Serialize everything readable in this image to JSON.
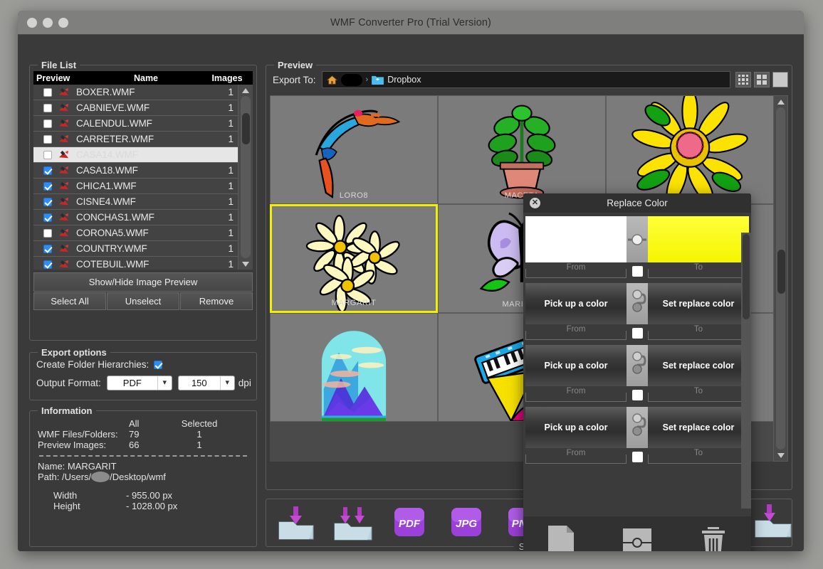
{
  "window": {
    "title": "WMF Converter Pro (Trial Version)",
    "traffic_labels": [
      "close",
      "minimize",
      "zoom"
    ]
  },
  "file_list": {
    "legend": "File List",
    "columns": [
      "Preview",
      "Name",
      "Images"
    ],
    "rows": [
      {
        "checked": false,
        "name": "BOXER.WMF",
        "images": "1",
        "selected": false
      },
      {
        "checked": false,
        "name": "CABNIEVE.WMF",
        "images": "1",
        "selected": false
      },
      {
        "checked": false,
        "name": "CALENDUL.WMF",
        "images": "1",
        "selected": false
      },
      {
        "checked": false,
        "name": "CARRETER.WMF",
        "images": "1",
        "selected": false
      },
      {
        "checked": false,
        "name": "CASA14.WMF",
        "images": "",
        "selected": true
      },
      {
        "checked": true,
        "name": "CASA18.WMF",
        "images": "1",
        "selected": false
      },
      {
        "checked": true,
        "name": "CHICA1.WMF",
        "images": "1",
        "selected": false
      },
      {
        "checked": true,
        "name": "CISNE4.WMF",
        "images": "1",
        "selected": false
      },
      {
        "checked": true,
        "name": "CONCHAS1.WMF",
        "images": "1",
        "selected": false
      },
      {
        "checked": false,
        "name": "CORONA5.WMF",
        "images": "1",
        "selected": false
      },
      {
        "checked": true,
        "name": "COUNTRY.WMF",
        "images": "1",
        "selected": false
      },
      {
        "checked": true,
        "name": "COTEBUIL.WMF",
        "images": "1",
        "selected": false
      }
    ],
    "show_hide_label": "Show/Hide Image Preview",
    "select_all_label": "Select All",
    "unselect_label": "Unselect",
    "remove_label": "Remove"
  },
  "export_options": {
    "legend": "Export options",
    "folder_hierarchies_label": "Create Folder Hierarchies:",
    "folder_hierarchies_checked": true,
    "output_format_label": "Output Format:",
    "format_value": "PDF",
    "dpi_value": "150",
    "dpi_unit": "dpi"
  },
  "information": {
    "legend": "Information",
    "col_all": "All",
    "col_selected": "Selected",
    "rows": [
      {
        "label": "WMF Files/Folders:",
        "all": "79",
        "selected": "1"
      },
      {
        "label": "Preview Images:",
        "all": "66",
        "selected": "1"
      }
    ],
    "name_label": "Name: MARGARIT",
    "path_prefix": "Path: /Users/",
    "path_suffix": "/Desktop/wmf",
    "width_label": "Width",
    "width_value": "- 955.00 px",
    "height_label": "Height",
    "height_value": "- 1028.00 px"
  },
  "preview": {
    "legend": "Preview",
    "export_to_label": "Export To:",
    "path_value": "Dropbox",
    "home_icon": "home-icon",
    "chevron_icon": "chevron-right-icon",
    "folder_icon": "dropbox-folder-icon",
    "view_modes": [
      "grid-3x3",
      "grid-2x2",
      "single-large"
    ],
    "thumbnails": [
      {
        "caption": "LORO8",
        "art": "parrot",
        "active": false
      },
      {
        "caption": "MACETA",
        "art": "plant",
        "active": false
      },
      {
        "caption": "",
        "art": "sunflower",
        "active": false
      },
      {
        "caption": "MARGARIT",
        "art": "daisies",
        "active": true
      },
      {
        "caption": "MARIPOS",
        "art": "butterfly",
        "active": false
      },
      {
        "caption": "",
        "art": "blank",
        "active": false
      },
      {
        "caption": "",
        "art": "mountains",
        "active": false
      },
      {
        "caption": "",
        "art": "keyboard",
        "active": false
      },
      {
        "caption": "",
        "art": "blank",
        "active": false
      }
    ]
  },
  "save_bar": {
    "legend": "Save",
    "buttons": [
      {
        "name": "save-to-folder-icon",
        "label": ""
      },
      {
        "name": "save-to-folders-icon",
        "label": ""
      },
      {
        "name": "save-as-pdf-icon",
        "label": "PDF"
      },
      {
        "name": "save-as-jpg-icon",
        "label": "JPG"
      },
      {
        "name": "save-as-png-icon",
        "label": "PNG"
      },
      {
        "name": "save-extra-icon",
        "label": ""
      }
    ]
  },
  "replace_color": {
    "title": "Replace Color",
    "close_icon": "close-icon",
    "from_label": "From",
    "to_label": "To",
    "pick_label": "Pick up a color",
    "set_label": "Set replace color",
    "swatch_from": "#ffffff",
    "swatch_to": "#f5f500",
    "rows": [
      {
        "type": "swatch",
        "from": "#ffffff",
        "to": "#f5f500",
        "checked": false
      },
      {
        "type": "empty",
        "pick": "Pick up a color",
        "set": "Set replace color",
        "checked": false
      },
      {
        "type": "empty",
        "pick": "Pick up a color",
        "set": "Set replace color",
        "checked": false
      },
      {
        "type": "empty",
        "pick": "Pick up a color",
        "set": "Set replace color",
        "checked": false
      }
    ],
    "toolbar": [
      {
        "name": "new-document-icon"
      },
      {
        "name": "replace-color-icon"
      },
      {
        "name": "delete-trash-icon"
      }
    ]
  },
  "colors": {
    "accent_blue": "#2d8cf6",
    "highlight_yellow": "#f2f000",
    "window_bg": "#3a3a3a",
    "titlebar": "#7f7f7d",
    "thumb_bg": "#7b7b7b"
  }
}
